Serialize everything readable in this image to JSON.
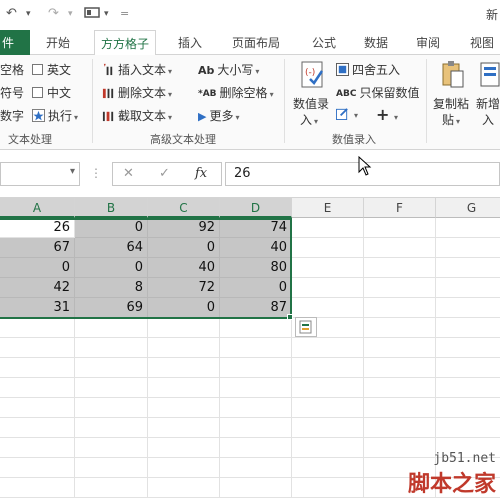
{
  "title_fragment": "新",
  "tabs": [
    "件",
    "开始",
    "方方格子",
    "插入",
    "页面布局",
    "公式",
    "数据",
    "审阅",
    "视图"
  ],
  "ribbon": {
    "text_group": {
      "items_col1": [
        "空格",
        "符号",
        "数字"
      ],
      "items_col2": [
        "英文",
        "中文",
        "执行"
      ],
      "label": "文本处理"
    },
    "advanced_group": {
      "items_col1": [
        "插入文本",
        "删除文本",
        "截取文本"
      ],
      "items_col2": [
        "大小写",
        "删除空格",
        "更多"
      ],
      "label": "高级文本处理"
    },
    "number_group": {
      "big_button_line1": "数值录",
      "big_button_line2": "入",
      "round_label": "四舍五入",
      "keep_label": "只保留数值",
      "label": "数值录入"
    },
    "copy_button_line1": "复制粘",
    "copy_button_line2": "贴",
    "new_button_line1": "新增",
    "new_button_line2": "入"
  },
  "formula_bar": {
    "name_box": "",
    "cancel_symbol": "✕",
    "enter_symbol": "✓",
    "fx_symbol": "fx",
    "value": "26"
  },
  "grid": {
    "columns": [
      "A",
      "B",
      "C",
      "D",
      "E",
      "F",
      "G"
    ],
    "rows": [
      [
        "26",
        "0",
        "92",
        "74"
      ],
      [
        "67",
        "64",
        "0",
        "40"
      ],
      [
        "0",
        "0",
        "40",
        "80"
      ],
      [
        "42",
        "8",
        "72",
        "0"
      ],
      [
        "31",
        "69",
        "0",
        "87"
      ]
    ]
  },
  "watermark": {
    "url": "jb51.net",
    "brand": "脚本之家"
  },
  "colors": {
    "accent": "#217346",
    "selection": "#c6c6c6",
    "watermark": "#c0392b"
  }
}
